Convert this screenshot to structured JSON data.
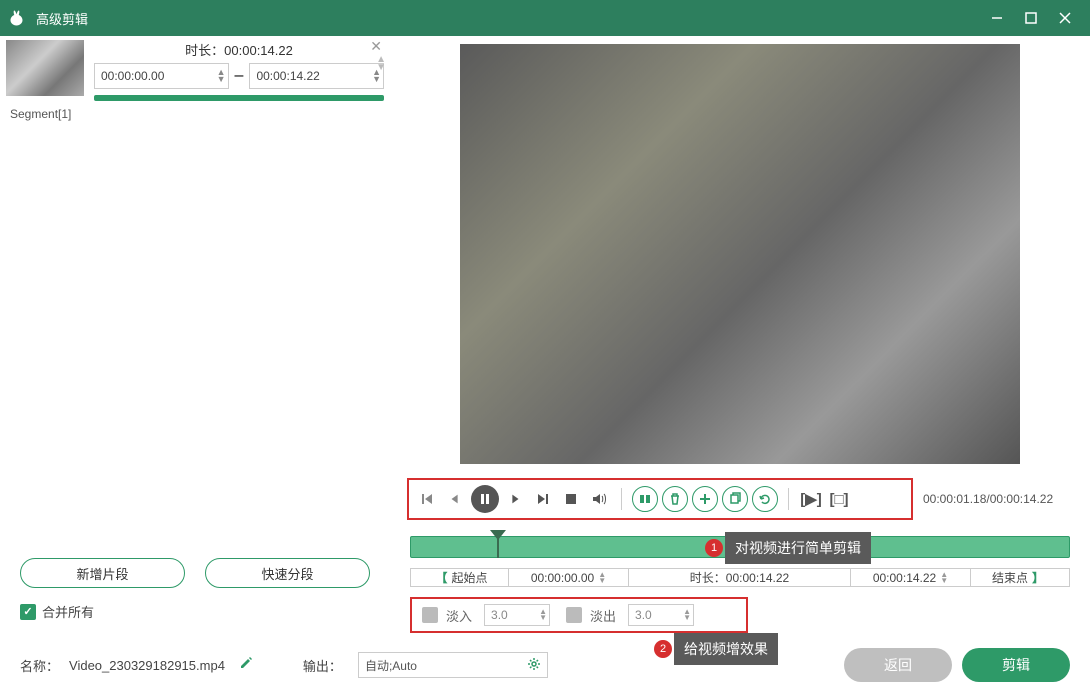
{
  "window": {
    "title": "高级剪辑"
  },
  "segment": {
    "duration_label": "时长：00:00:14.22",
    "start": "00:00:00.00",
    "end": "00:00:14.22",
    "name": "Segment[1]"
  },
  "left_buttons": {
    "new_segment": "新增片段",
    "quick_split": "快速分段"
  },
  "merge_all": "合并所有",
  "playback": {
    "time_readout": "00:00:01.18/00:00:14.22"
  },
  "range_row": {
    "start_label": "起始点",
    "start_time": "00:00:00.00",
    "mid_label": "时长：00:00:14.22",
    "end_time": "00:00:14.22",
    "end_label": "结束点"
  },
  "fade": {
    "in_label": "淡入",
    "in_value": "3.0",
    "out_label": "淡出",
    "out_value": "3.0"
  },
  "annotations": {
    "tip1_num": "1",
    "tip1_text": "对视频进行简单剪辑",
    "tip2_num": "2",
    "tip2_text": "给视频增效果"
  },
  "bottom": {
    "name_label": "名称：",
    "name_value": "Video_230329182915.mp4",
    "output_label": "输出：",
    "output_value": "自动;Auto",
    "back": "返回",
    "cut": "剪辑"
  }
}
